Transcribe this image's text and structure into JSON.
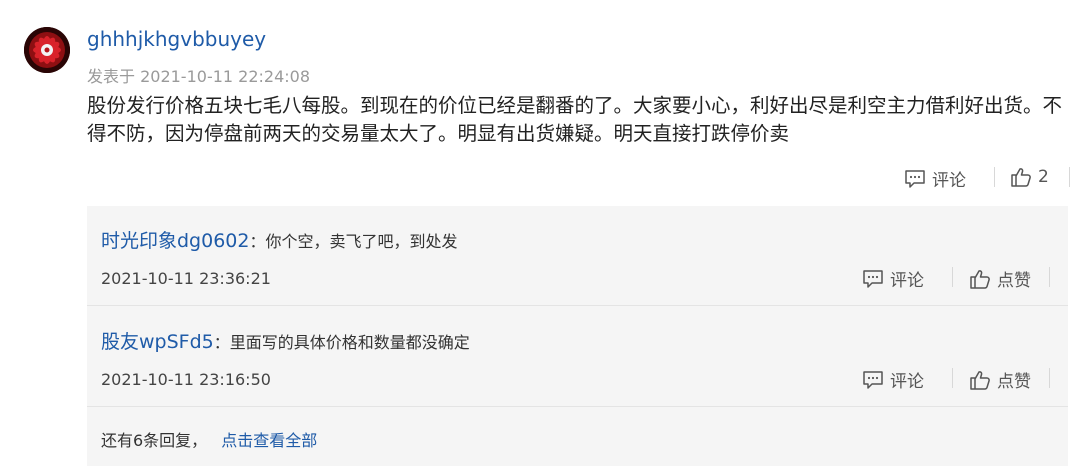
{
  "post": {
    "username": "ghhhjkhgvbbuyey",
    "time": "发表于 2021-10-11 22:24:08",
    "body": "股份发行价格五块七毛八每股。到现在的价位已经是翻番的了。大家要小心，利好出尽是利空主力借利好出货。不得不防，因为停盘前两天的交易量太大了。明显有出货嫌疑。明天直接打跌停价卖",
    "comment_label": "评论",
    "like_count": "2"
  },
  "replies": [
    {
      "name": "时光印象dg0602",
      "colon": "：",
      "text": "你个空，卖飞了吧，到处发",
      "time": "2021-10-11 23:36:21",
      "comment_label": "评论",
      "like_label": "点赞"
    },
    {
      "name": "股友wpSFd5",
      "colon": "：",
      "text": "里面写的具体价格和数量都没确定",
      "time": "2021-10-11 23:16:50",
      "comment_label": "评论",
      "like_label": "点赞"
    }
  ],
  "more": {
    "text": "还有6条回复，",
    "link": "点击查看全部"
  },
  "colors": {
    "link": "#1f5ba8",
    "reply_bg": "#f5f5f5",
    "avatar_red": "#c4161c"
  },
  "icons": [
    "avatar",
    "comment-icon",
    "thumbs-up-icon"
  ]
}
